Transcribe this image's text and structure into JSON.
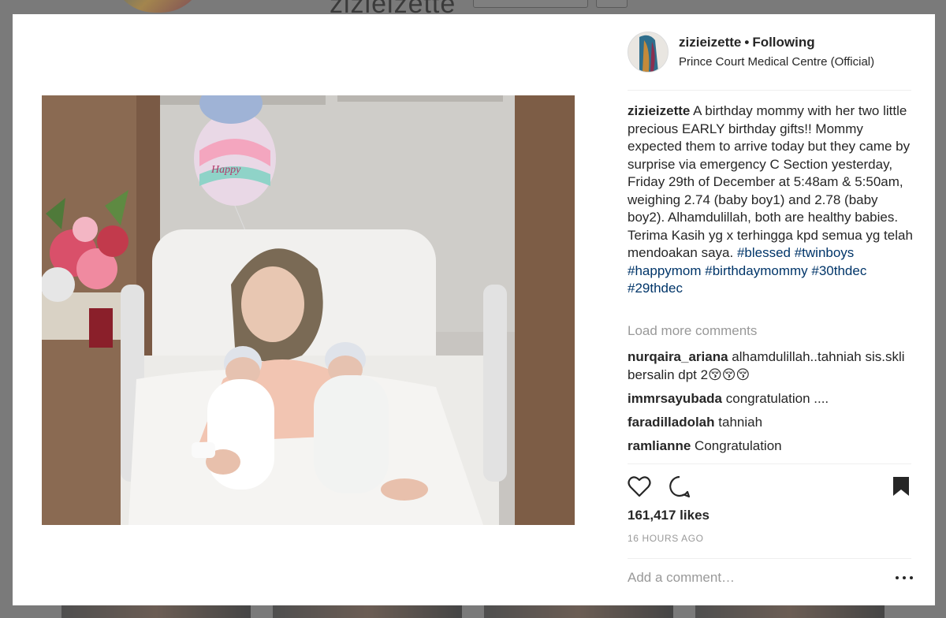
{
  "background": {
    "profile_username": "zizieizette"
  },
  "post": {
    "username": "zizieizette",
    "follow_status": "Following",
    "separator": "•",
    "location": "Prince Court Medical Centre (Official)",
    "caption_user": "zizieizette",
    "caption_text": "A birthday mommy with her two little precious EARLY birthday gifts!! Mommy expected them to arrive today but they came by surprise via emergency C Section yesterday, Friday 29th of December at 5:48am & 5:50am, weighing 2.74 (baby boy1) and 2.78 (baby boy2). Alhamdulillah, both are healthy babies. Terima Kasih yg x terhingga kpd semua yg telah mendoakan saya.",
    "hashtags": "#blessed #twinboys #happymom #birthdaymommy #30thdec #29thdec",
    "load_more": "Load more comments",
    "comments": [
      {
        "user": "nurqaira_ariana",
        "text": "alhamdulillah..tahniah sis.skli bersalin dpt 2😚😚😚"
      },
      {
        "user": "immrsayubada",
        "text": "congratulation ...."
      },
      {
        "user": "faradilladolah",
        "text": "tahniah"
      },
      {
        "user": "ramlianne",
        "text": "Congratulation"
      }
    ],
    "likes": "161,417 likes",
    "time": "16 HOURS AGO",
    "add_comment_placeholder": "Add a comment…",
    "icons": {
      "like": "heart-icon",
      "comment": "comment-bubble-icon",
      "save": "bookmark-icon",
      "more": "ellipsis-icon"
    }
  },
  "colors": {
    "text": "#262626",
    "muted": "#999999",
    "hashtag": "#003569",
    "divider": "#efefef"
  }
}
